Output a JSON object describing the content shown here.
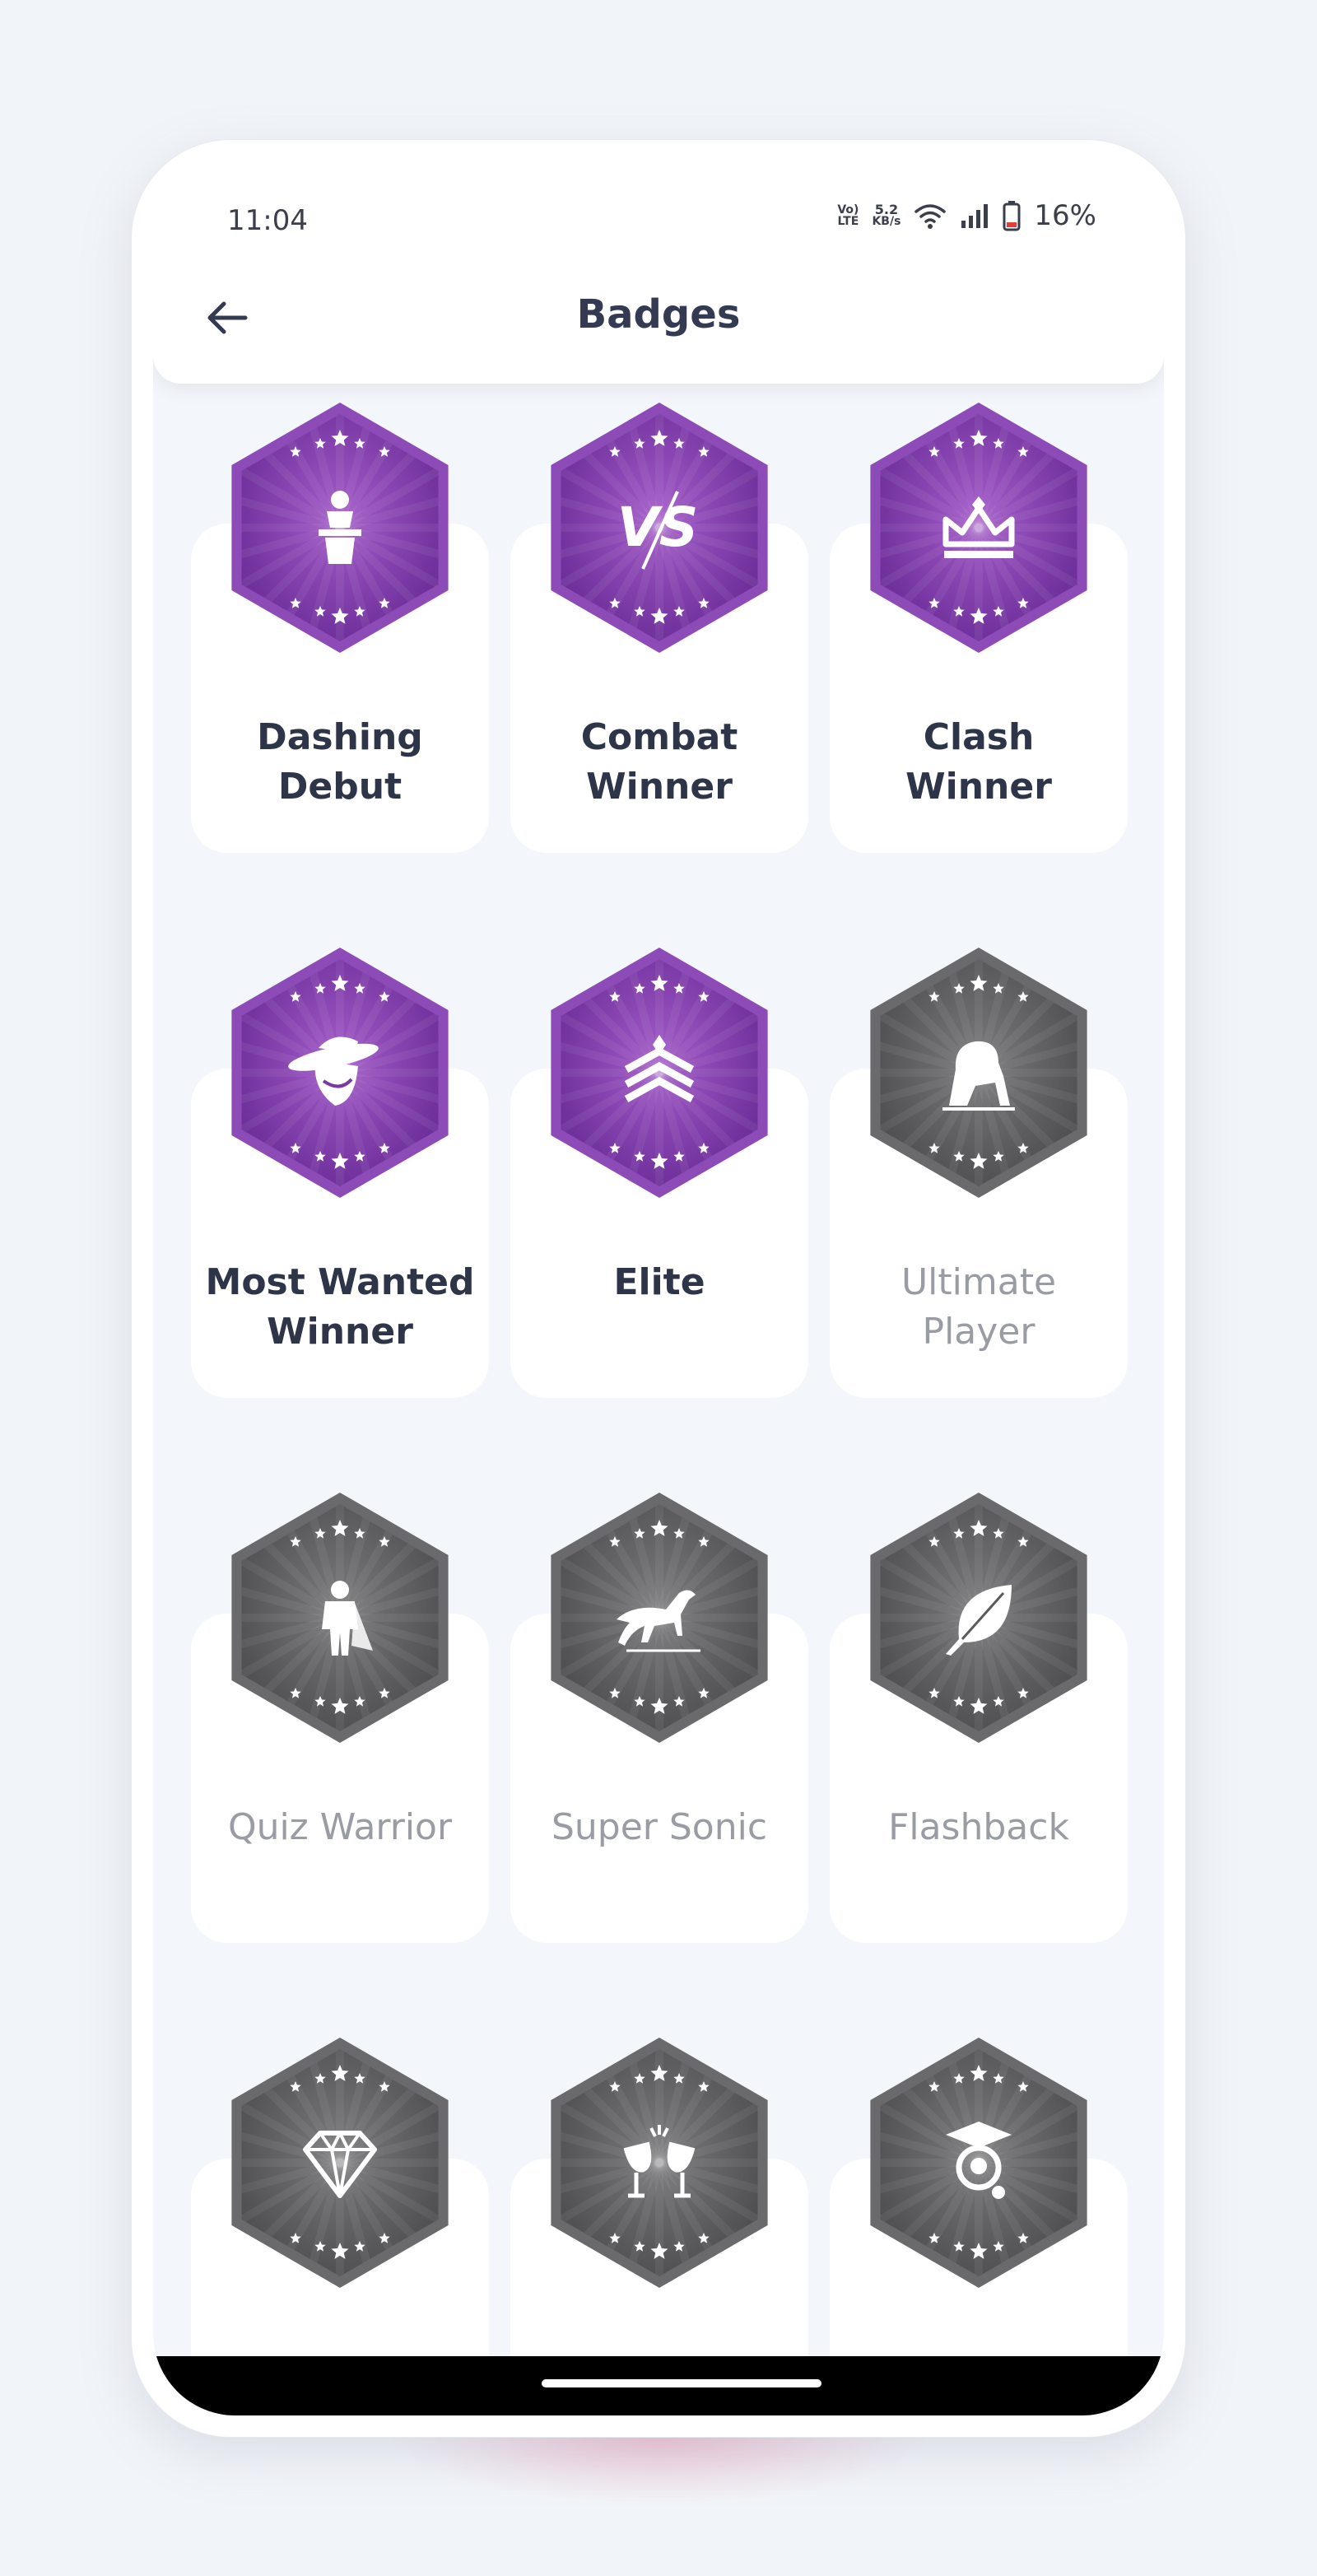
{
  "status_bar": {
    "time": "11:04",
    "network_top": "Vo)",
    "network_bottom": "LTE",
    "speed_top": "5.2",
    "speed_bottom": "KB/s",
    "battery": "16%"
  },
  "header": {
    "title": "Badges"
  },
  "colors": {
    "earned": "#7a3aa3",
    "locked": "#5a5a5c",
    "title": "#343a52"
  },
  "badges": [
    {
      "label_line1": "Dashing",
      "label_line2": "Debut",
      "earned": true,
      "icon": "speaker-podium-icon"
    },
    {
      "label_line1": "Combat",
      "label_line2": "Winner",
      "earned": true,
      "icon": "versus-icon"
    },
    {
      "label_line1": "Clash",
      "label_line2": "Winner",
      "earned": true,
      "icon": "crown-icon"
    },
    {
      "label_line1": "Most Wanted",
      "label_line2": "Winner",
      "earned": true,
      "icon": "cowboy-icon"
    },
    {
      "label_line1": "Elite",
      "label_line2": "",
      "earned": true,
      "icon": "rank-chevron-icon"
    },
    {
      "label_line1": "Ultimate",
      "label_line2": "Player",
      "earned": false,
      "icon": "lion-icon"
    },
    {
      "label_line1": "Quiz Warrior",
      "label_line2": "",
      "earned": false,
      "icon": "superhero-icon"
    },
    {
      "label_line1": "Super Sonic",
      "label_line2": "",
      "earned": false,
      "icon": "horse-icon"
    },
    {
      "label_line1": "Flashback",
      "label_line2": "",
      "earned": false,
      "icon": "feather-icon"
    },
    {
      "label_line1": "",
      "label_line2": "",
      "earned": false,
      "icon": "diamond-icon"
    },
    {
      "label_line1": "",
      "label_line2": "",
      "earned": false,
      "icon": "cheers-glasses-icon"
    },
    {
      "label_line1": "",
      "label_line2": "",
      "earned": false,
      "icon": "graduate-icon"
    }
  ]
}
